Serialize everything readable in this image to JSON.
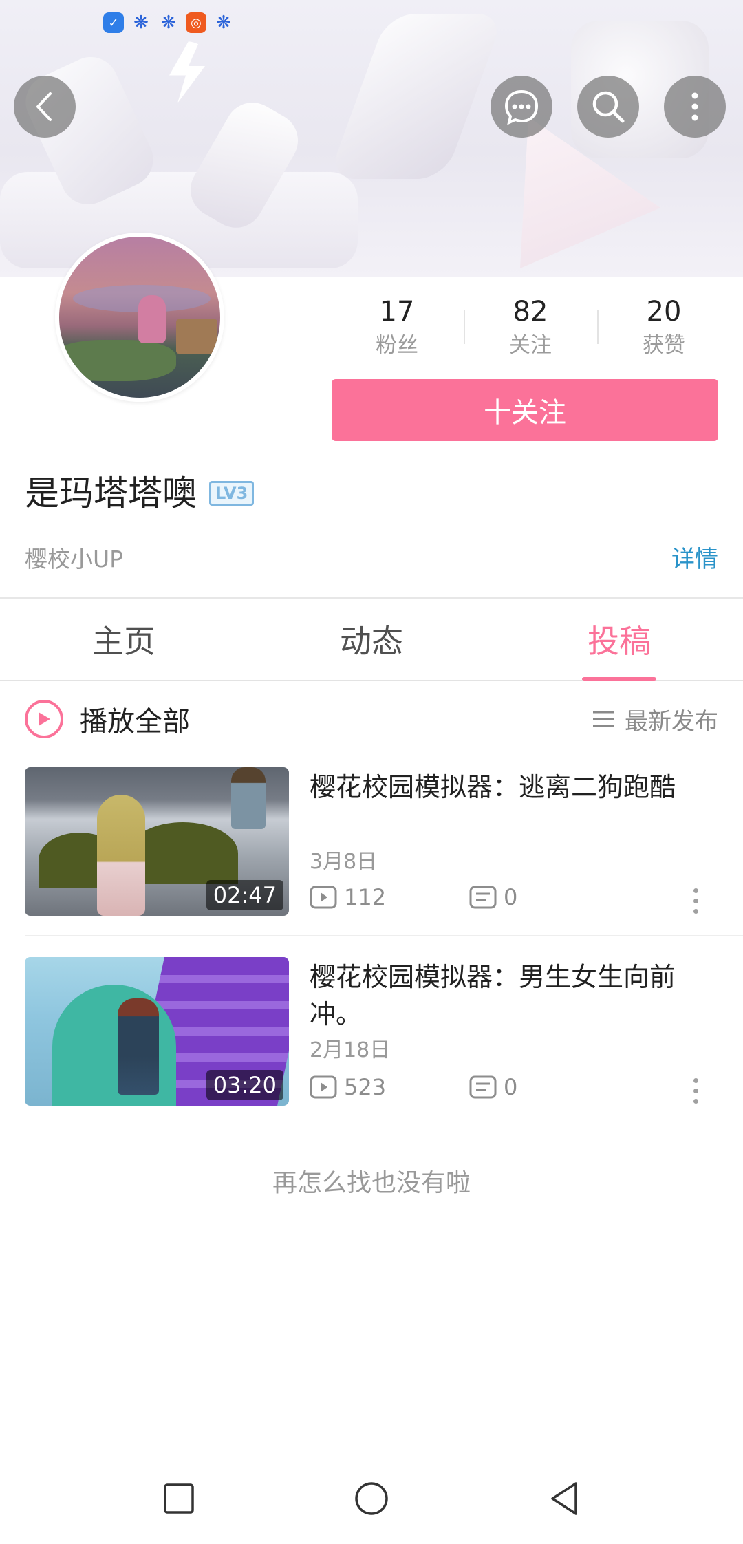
{
  "header": {
    "status_icons": [
      "shield-icon",
      "baidu-paw-icon",
      "baidu-paw-icon",
      "app-icon",
      "baidu-paw-icon"
    ],
    "buttons": [
      "back-icon",
      "message-icon",
      "search-icon",
      "more-vertical-icon"
    ]
  },
  "profile": {
    "fans_count": "17",
    "fans_label": "粉丝",
    "following_count": "82",
    "following_label": "关注",
    "likes_count": "20",
    "likes_label": "获赞",
    "follow_button_label": "十关注",
    "username": "是玛塔塔噢",
    "level_badge": "LV3",
    "signature": "樱校小UP",
    "detail_link": "详情"
  },
  "tabs": [
    {
      "label": "主页",
      "active": false
    },
    {
      "label": "动态",
      "active": false
    },
    {
      "label": "投稿",
      "active": true
    }
  ],
  "list_header": {
    "play_all_label": "播放全部",
    "sort_label": "最新发布"
  },
  "videos": [
    {
      "title": "樱花校园模拟器：逃离二狗跑酷",
      "date": "3月8日",
      "duration": "02:47",
      "plays": "112",
      "comments": "0"
    },
    {
      "title": "樱花校园模拟器：男生女生向前冲。",
      "date": "2月18日",
      "duration": "03:20",
      "plays": "523",
      "comments": "0"
    }
  ],
  "end_hint": "再怎么找也没有啦",
  "colors": {
    "accent": "#fb7299",
    "link": "#2a93c9",
    "level_badge": "#7fb7e0"
  },
  "navbar": [
    "recent-apps-icon",
    "home-icon",
    "back-triangle-icon"
  ]
}
